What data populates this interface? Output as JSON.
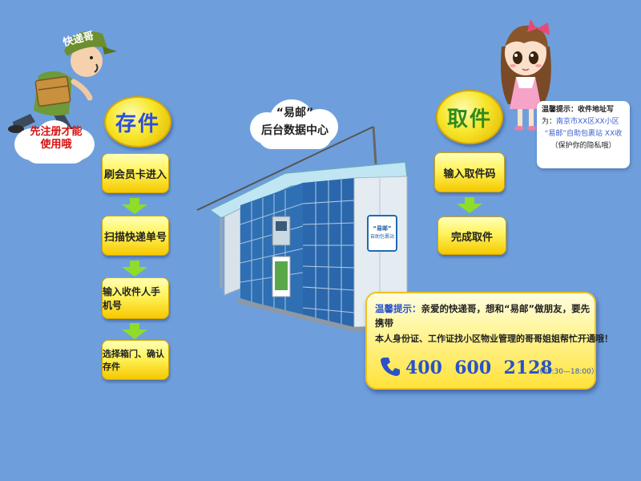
{
  "courier": {
    "cap_text": "快递哥",
    "register_note": "先注册才能使用哦"
  },
  "deposit": {
    "title": "存件",
    "steps": [
      "刷会员卡进入",
      "扫描快递单号",
      "输入收件人手机号",
      "选择箱门、确认存件"
    ]
  },
  "center": {
    "title_line1": "“易邮”",
    "title_line2": "后台数据中心"
  },
  "kiosk": {
    "sign_line1": "“易邮”",
    "sign_line2": "自助包裹站"
  },
  "pickup": {
    "title": "取件",
    "steps": [
      "输入取件码",
      "完成取件"
    ]
  },
  "tip_small": {
    "line1": "温馨提示：收件地址写",
    "line2_prefix": "为：",
    "line2_highlight": "南京市XX区XX小区",
    "line3_highlight": "“易邮”自助包裹站 XX收",
    "line4": "（保护你的隐私哦）"
  },
  "tip_large": {
    "line1_label": "温馨提示：",
    "line1_text": "亲爱的快递哥，想和“易邮”做朋友，要先携带",
    "line2": "本人身份证、工作证找小区物业管理的哥哥姐姐帮忙开通哦！",
    "phone": "400  600  2128",
    "hours": "（08:30—18:00）"
  },
  "colors": {
    "background": "#6e9fdc",
    "deposit_title": "#2c4fd8",
    "pickup_title": "#2f8a1c",
    "highlight": "#3a5fd0",
    "arrow": "#8fdc2a"
  }
}
